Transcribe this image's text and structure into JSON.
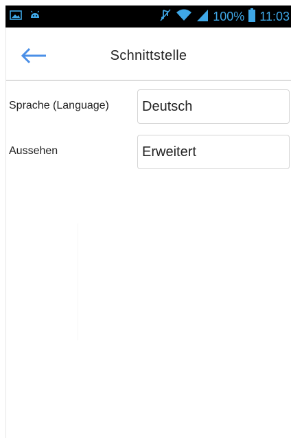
{
  "status_bar": {
    "battery_percent": "100%",
    "time": "11:03",
    "icons": [
      "image-icon",
      "android-icon",
      "mute-icon",
      "wifi-icon",
      "signal-icon",
      "battery-icon"
    ],
    "icon_color": "#3fa7e6"
  },
  "header": {
    "back_icon": "arrow-left-icon",
    "title": "Schnittstelle",
    "accent_color": "#4a8fe7"
  },
  "settings": [
    {
      "label": "Sprache (Language)",
      "value": "Deutsch"
    },
    {
      "label": "Aussehen",
      "value": "Erweitert"
    }
  ]
}
